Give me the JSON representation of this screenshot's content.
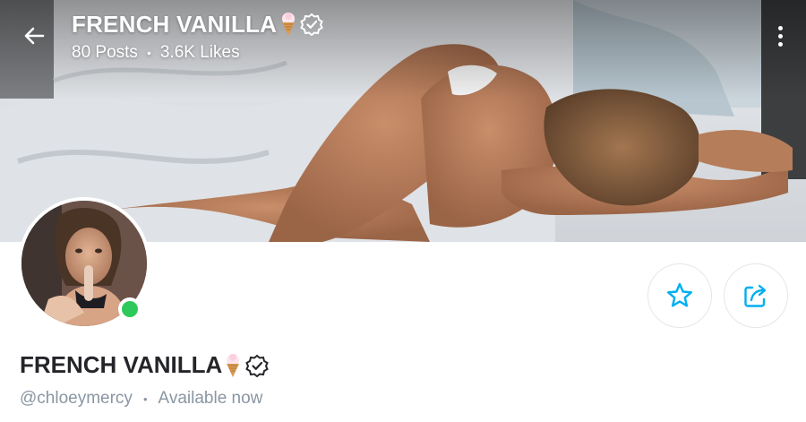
{
  "header": {
    "title": "FRENCH VANILLA",
    "posts": "80 Posts",
    "separator": "•",
    "likes": "3.6K Likes"
  },
  "icons": {
    "back": "arrow-left-icon",
    "title_emoji": "ice-cream-icon",
    "verified": "verified-badge-icon",
    "more": "more-vertical-icon",
    "favorite": "star-icon",
    "share": "share-icon"
  },
  "profile": {
    "name": "FRENCH VANILLA",
    "handle": "@chloeymercy",
    "separator": "•",
    "status": "Available now",
    "online": true
  },
  "colors": {
    "accent": "#00aff0",
    "online": "#2ec95a",
    "name_text": "#242529",
    "muted_text": "#8a96a3",
    "button_border": "#e4e6ea"
  }
}
